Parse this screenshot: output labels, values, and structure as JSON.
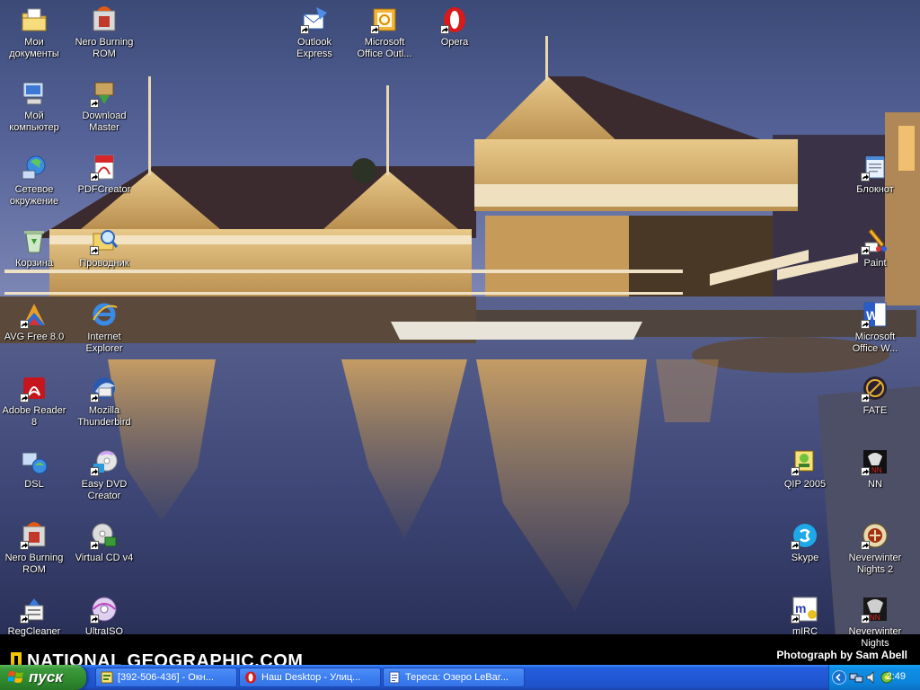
{
  "wallpaper": {
    "brand": "NATIONAL GEOGRAPHIC.COM",
    "credit": "Photograph by Sam Abell",
    "brand_color": "#f5c400"
  },
  "desktop_icons": [
    {
      "label": "Мои документы",
      "icon": "my-documents-icon",
      "shortcut": false
    },
    {
      "label": "Nero Burning ROM",
      "icon": "nero-icon",
      "shortcut": false
    },
    {
      "label": "Outlook Express",
      "icon": "outlook-express-icon",
      "shortcut": true
    },
    {
      "label": "Microsoft Office Outl...",
      "icon": "office-outlook-icon",
      "shortcut": true
    },
    {
      "label": "Opera",
      "icon": "opera-icon",
      "shortcut": true
    },
    {
      "label": "Мой компьютер",
      "icon": "my-computer-icon",
      "shortcut": false
    },
    {
      "label": "Download Master",
      "icon": "download-master-icon",
      "shortcut": true
    },
    {
      "label": "Сетевое окружение",
      "icon": "network-places-icon",
      "shortcut": false
    },
    {
      "label": "PDFCreator",
      "icon": "pdfcreator-icon",
      "shortcut": true
    },
    {
      "label": "Блокнот",
      "icon": "notepad-icon",
      "shortcut": true
    },
    {
      "label": "Корзина",
      "icon": "recycle-bin-icon",
      "shortcut": false
    },
    {
      "label": "Проводник",
      "icon": "explorer-icon",
      "shortcut": true
    },
    {
      "label": "Paint",
      "icon": "paint-icon",
      "shortcut": true
    },
    {
      "label": "AVG Free 8.0",
      "icon": "avg-icon",
      "shortcut": true
    },
    {
      "label": "Internet Explorer",
      "icon": "internet-explorer-icon",
      "shortcut": false
    },
    {
      "label": "Microsoft Office W...",
      "icon": "word-icon",
      "shortcut": true
    },
    {
      "label": "Adobe Reader 8",
      "icon": "adobe-reader-icon",
      "shortcut": true
    },
    {
      "label": "Mozilla Thunderbird",
      "icon": "thunderbird-icon",
      "shortcut": true
    },
    {
      "label": "FATE",
      "icon": "fate-icon",
      "shortcut": true
    },
    {
      "label": "DSL",
      "icon": "dsl-icon",
      "shortcut": false
    },
    {
      "label": "Easy DVD Creator",
      "icon": "easy-dvd-icon",
      "shortcut": true
    },
    {
      "label": "QIP 2005",
      "icon": "qip-icon",
      "shortcut": true
    },
    {
      "label": "NN",
      "icon": "nn-icon",
      "shortcut": true
    },
    {
      "label": "Nero Burning ROM",
      "icon": "nero-icon",
      "shortcut": true
    },
    {
      "label": "Virtual CD v4",
      "icon": "virtual-cd-icon",
      "shortcut": true
    },
    {
      "label": "Skype",
      "icon": "skype-icon",
      "shortcut": true
    },
    {
      "label": "Neverwinter Nights 2",
      "icon": "nwn2-icon",
      "shortcut": true
    },
    {
      "label": "RegCleaner",
      "icon": "regcleaner-icon",
      "shortcut": true
    },
    {
      "label": "UltraISO",
      "icon": "ultraiso-icon",
      "shortcut": true
    },
    {
      "label": "mIRC",
      "icon": "mirc-icon",
      "shortcut": true
    },
    {
      "label": "Neverwinter Nights",
      "icon": "nwn-icon",
      "shortcut": true
    }
  ],
  "taskbar": {
    "start_label": "пуск",
    "tasks": [
      {
        "label": "[392-506-436] - Окн...",
        "icon": "qip-chat-icon"
      },
      {
        "label": "Наш Desktop - Улиц...",
        "icon": "opera-icon"
      },
      {
        "label": "Тереса: Озеро LeBar...",
        "icon": "document-icon"
      }
    ],
    "clock": "2:49",
    "tray_icons": [
      "expand-tray-icon",
      "network-tray-icon",
      "volume-tray-icon",
      "qip-tray-icon"
    ]
  }
}
